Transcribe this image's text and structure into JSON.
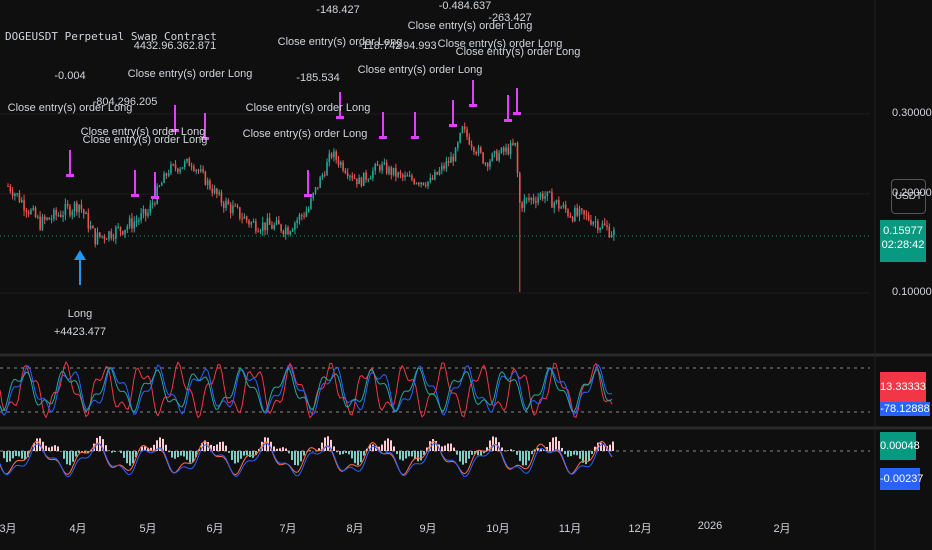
{
  "header": {
    "symbol_title": "DOGEUSDT Perpetual Swap Contract",
    "currency": "USDT"
  },
  "price_axis": {
    "ticks": [
      "0.30000",
      "0.20000",
      "0.10000"
    ],
    "last_price": "0.15977",
    "countdown": "02:28:42",
    "last_color": "#089981"
  },
  "osc1": {
    "value_a": "13.33333",
    "value_b": "-78.12888",
    "color_a": "#f23645",
    "color_b": "#2962ff"
  },
  "osc2": {
    "value_a": "0.00048",
    "value_b": "-0.00237",
    "color_a": "#089981",
    "color_b": "#2962ff"
  },
  "time_axis": [
    "3月",
    "4月",
    "5月",
    "6月",
    "7月",
    "8月",
    "9月",
    "10月",
    "11月",
    "12月",
    "2026",
    "2月"
  ],
  "annotations": [
    {
      "text": "-0.004",
      "x": 70,
      "y": 70
    },
    {
      "text": "Close entry(s) order Long",
      "x": 70,
      "y": 102
    },
    {
      "text": "Close entry(s) order Long",
      "x": 190,
      "y": 68
    },
    {
      "text": "-804.296.205",
      "x": 125,
      "y": 96
    },
    {
      "text": "Close entry(s) order Long",
      "x": 143,
      "y": 126
    },
    {
      "text": "Close entry(s) order Long",
      "x": 145,
      "y": 134
    },
    {
      "text": "4432.96.362.871",
      "x": 175,
      "y": 40
    },
    {
      "text": "-148.427",
      "x": 338,
      "y": 4
    },
    {
      "text": "Close entry(s) order Long",
      "x": 340,
      "y": 36
    },
    {
      "text": "-185.534",
      "x": 318,
      "y": 72
    },
    {
      "text": "Close entry(s) order Long",
      "x": 308,
      "y": 102
    },
    {
      "text": "Close entry(s) order Long",
      "x": 305,
      "y": 128
    },
    {
      "text": "-118.742",
      "x": 380,
      "y": 40
    },
    {
      "text": "-94.993",
      "x": 418,
      "y": 40
    },
    {
      "text": "Close entry(s) order Long",
      "x": 420,
      "y": 64
    },
    {
      "text": "-0.484.637",
      "x": 465,
      "y": 0
    },
    {
      "text": "Close entry(s) order Long",
      "x": 470,
      "y": 20
    },
    {
      "text": "Close entry(s) order Long",
      "x": 500,
      "y": 38
    },
    {
      "text": "Close entry(s) order Long",
      "x": 518,
      "y": 46
    },
    {
      "text": "-263.427",
      "x": 510,
      "y": 12
    },
    {
      "text": "Long",
      "x": 80,
      "y": 308
    },
    {
      "text": "+4423.477",
      "x": 80,
      "y": 326
    }
  ],
  "chart_data": {
    "type": "candlestick",
    "title": "DOGEUSDT Perpetual Swap Contract",
    "ylabel": "USDT",
    "ylim": [
      0.08,
      0.34
    ],
    "x_ticks": [
      "3月",
      "4月",
      "5月",
      "6月",
      "7月",
      "8月",
      "9月",
      "10月",
      "11月",
      "12月",
      "2026",
      "2月"
    ],
    "dates": [
      "2025-03-01",
      "2025-03-15",
      "2025-04-01",
      "2025-04-08",
      "2025-04-20",
      "2025-05-01",
      "2025-05-10",
      "2025-05-20",
      "2025-06-01",
      "2025-06-15",
      "2025-07-01",
      "2025-07-10",
      "2025-07-20",
      "2025-08-01",
      "2025-08-10",
      "2025-08-20",
      "2025-09-01",
      "2025-09-12",
      "2025-09-15",
      "2025-09-25",
      "2025-10-01",
      "2025-10-08",
      "2025-10-10",
      "2025-10-20",
      "2025-11-01",
      "2025-11-10",
      "2025-11-20"
    ],
    "close": [
      0.21,
      0.17,
      0.19,
      0.155,
      0.165,
      0.18,
      0.23,
      0.24,
      0.195,
      0.17,
      0.165,
      0.185,
      0.25,
      0.215,
      0.235,
      0.22,
      0.215,
      0.25,
      0.28,
      0.24,
      0.25,
      0.26,
      0.19,
      0.2,
      0.18,
      0.175,
      0.16
    ],
    "last_price": 0.15977,
    "trades": {
      "entry_marks": [
        "Long"
      ],
      "exit_marks": [
        "Close entry(s) order Long"
      ]
    }
  }
}
